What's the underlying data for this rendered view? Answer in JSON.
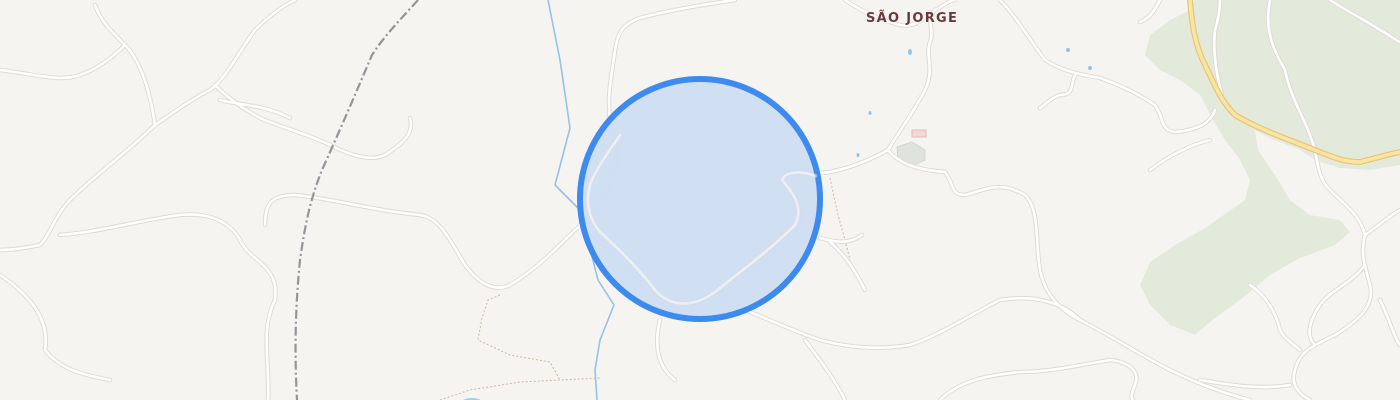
{
  "map": {
    "places": [
      {
        "name": "SÃO JORGE",
        "kind": "village"
      }
    ],
    "colors": {
      "background": "#f6f4f1",
      "forest": "#e4eadb",
      "road": "#ffffff",
      "main_road": "#fbe3a1",
      "river": "#94c2ee",
      "railway": "#9a929a",
      "area_fill": "#cddcf3",
      "area_outline": "#3d8bef",
      "label": "#6b3a3a"
    },
    "selected_area": {
      "shape": "circle"
    }
  }
}
